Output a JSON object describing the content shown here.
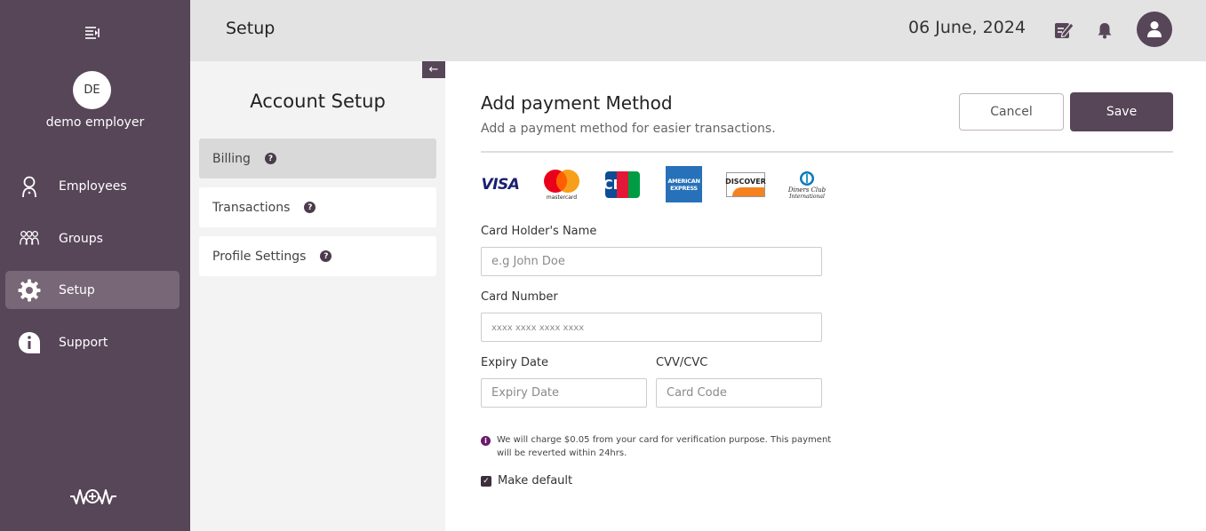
{
  "sidebar": {
    "avatar_initials": "DE",
    "user_name": "demo employer",
    "items": [
      {
        "label": "Employees",
        "icon": "employee-icon"
      },
      {
        "label": "Groups",
        "icon": "groups-icon"
      },
      {
        "label": "Setup",
        "icon": "gear-icon",
        "active": true
      },
      {
        "label": "Support",
        "icon": "info-icon"
      }
    ]
  },
  "topbar": {
    "title": "Setup",
    "date": "06 June, 2024"
  },
  "account_setup": {
    "title": "Account Setup",
    "collapse_glyph": "←",
    "items": [
      {
        "label": "Billing",
        "active": true
      },
      {
        "label": "Transactions"
      },
      {
        "label": "Profile Settings"
      }
    ],
    "help_glyph": "?"
  },
  "main": {
    "title": "Add payment Method",
    "subtitle": "Add a payment method for easier transactions.",
    "cancel_label": "Cancel",
    "save_label": "Save",
    "card_logos": {
      "visa": "VISA",
      "mastercard": "mastercard",
      "jcb": "JCB",
      "amex_line1": "AMERICAN",
      "amex_line2": "EXPRESS",
      "discover": "DISCOVER",
      "diners_line1": "Diners Club",
      "diners_line2": "International"
    },
    "form": {
      "holder_label": "Card Holder's Name",
      "holder_placeholder": "e.g John Doe",
      "number_label": "Card Number",
      "number_placeholder": "xxxx xxxx xxxx xxxx",
      "expiry_label": "Expiry Date",
      "expiry_placeholder": "Expiry Date",
      "cvv_label": "CVV/CVC",
      "cvv_placeholder": "Card Code"
    },
    "info_text": "We will charge $0.05 from your card for verification purpose. This payment will be reverted within 24hrs.",
    "make_default_label": "Make default",
    "make_default_checked": true
  },
  "colors": {
    "brand": "#574558",
    "sidebar_active": "#776777",
    "topbar_bg": "#e3e3e3",
    "panel_bg": "#f3f3f3"
  }
}
